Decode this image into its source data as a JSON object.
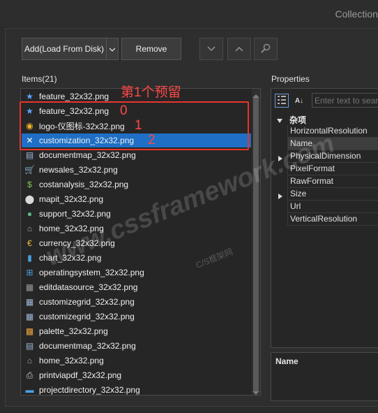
{
  "window": {
    "title": "Collection"
  },
  "toolbar": {
    "add_label": "Add(Load From Disk)",
    "add_dropdown_icon": "chevron-down",
    "remove_label": "Remove",
    "move_down_icon": "chevron-down",
    "move_up_icon": "chevron-up",
    "search_icon": "magnifier"
  },
  "items": {
    "header": "Items(21)",
    "list": [
      {
        "label": "feature_32x32.png",
        "icon": "star"
      },
      {
        "label": "feature_32x32.png",
        "icon": "star"
      },
      {
        "label": "logo-仪图标-32x32.png",
        "icon": "logo"
      },
      {
        "label": "customization_32x32.png",
        "icon": "tools",
        "selected": true
      },
      {
        "label": "documentmap_32x32.png",
        "icon": "document-map"
      },
      {
        "label": "newsales_32x32.png",
        "icon": "cart"
      },
      {
        "label": "costanalysis_32x32.png",
        "icon": "money-bag"
      },
      {
        "label": "mapit_32x32.png",
        "icon": "map-pin"
      },
      {
        "label": "support_32x32.png",
        "icon": "speech-bubble"
      },
      {
        "label": "home_32x32.png",
        "icon": "home"
      },
      {
        "label": "currency_32x32.png",
        "icon": "coins"
      },
      {
        "label": "chart_32x32.png",
        "icon": "bar-chart"
      },
      {
        "label": "operatingsystem_32x32.png",
        "icon": "windows"
      },
      {
        "label": "editdatasource_32x32.png",
        "icon": "database"
      },
      {
        "label": "customizegrid_32x32.png",
        "icon": "grid"
      },
      {
        "label": "customizegrid_32x32.png",
        "icon": "grid"
      },
      {
        "label": "palette_32x32.png",
        "icon": "palette"
      },
      {
        "label": "documentmap_32x32.png",
        "icon": "document-map"
      },
      {
        "label": "home_32x32.png",
        "icon": "home"
      },
      {
        "label": "printviapdf_32x32.png",
        "icon": "printer"
      },
      {
        "label": "projectdirectory_32x32.png",
        "icon": "folder"
      }
    ]
  },
  "properties": {
    "header": "Properties",
    "search_placeholder": "Enter text to search",
    "category": "杂项",
    "rows": [
      {
        "name": "HorizontalResolution",
        "expandable": false
      },
      {
        "name": "Name",
        "expandable": false,
        "selected": true
      },
      {
        "name": "PhysicalDimension",
        "expandable": true
      },
      {
        "name": "PixelFormat",
        "expandable": false
      },
      {
        "name": "RawFormat",
        "expandable": false
      },
      {
        "name": "Size",
        "expandable": true
      },
      {
        "name": "Url",
        "expandable": false
      },
      {
        "name": "VerticalResolution",
        "expandable": false
      }
    ],
    "description_title": "Name"
  },
  "annotations": {
    "note": "第1个预留",
    "index_0": "0",
    "index_1": "1",
    "index_2": "2"
  },
  "watermark": {
    "main": "www.cssframework.com",
    "sub": "C/S框架网"
  },
  "colors": {
    "selection": "#1e6fc5",
    "annotation": "#e8352b",
    "background": "#2b2b2b"
  }
}
